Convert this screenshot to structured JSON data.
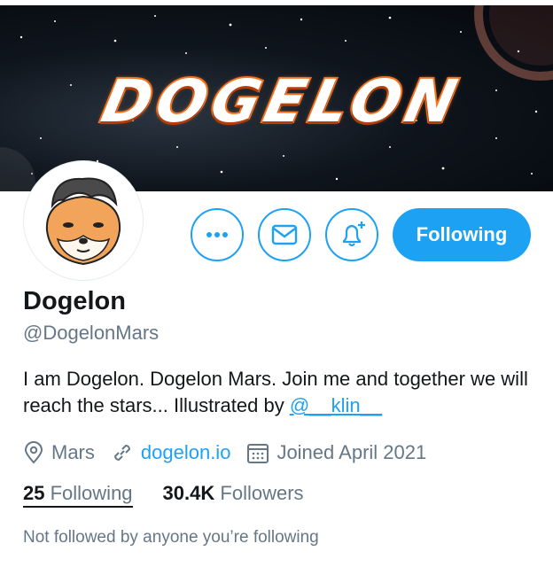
{
  "banner": {
    "title": "DOGELON"
  },
  "profile": {
    "display_name": "Dogelon",
    "handle": "@DogelonMars",
    "bio_text": "I am Dogelon. Dogelon Mars. Join me and together we will reach the stars... Illustrated by ",
    "bio_mention": "@__klin__"
  },
  "actions": {
    "more_icon": "more-dots-icon",
    "message_icon": "envelope-icon",
    "notify_icon": "bell-plus-icon",
    "follow_label": "Following"
  },
  "meta": {
    "location": "Mars",
    "website": "dogelon.io",
    "joined": "Joined April 2021"
  },
  "stats": {
    "following_count": "25",
    "following_label": "Following",
    "followers_count": "30.4K",
    "followers_label": "Followers"
  },
  "footer_note": "Not followed by anyone you’re following",
  "colors": {
    "accent": "#1da1f2",
    "muted": "#657786",
    "text": "#14171a"
  }
}
